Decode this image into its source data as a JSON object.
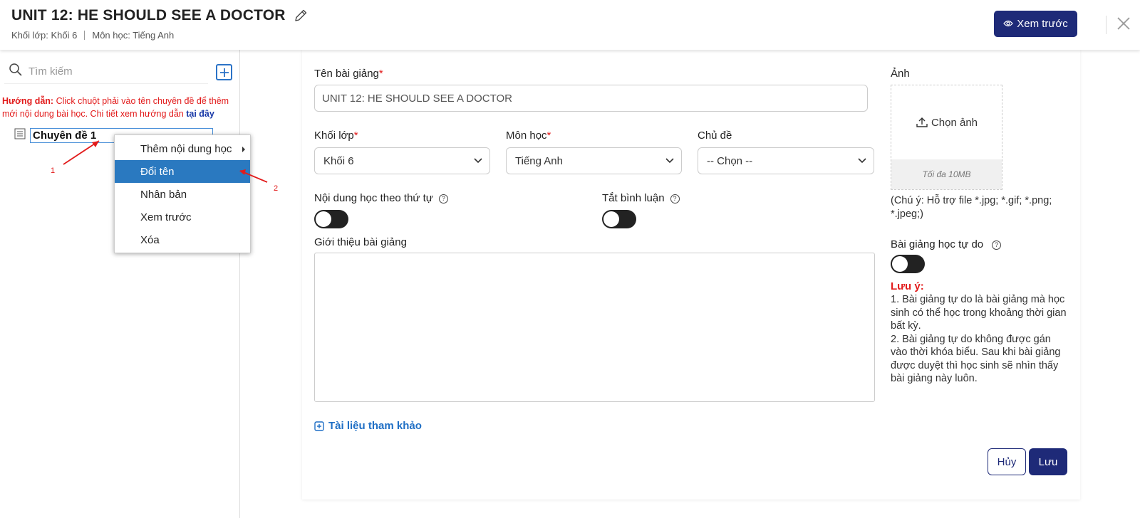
{
  "header": {
    "title": "UNIT 12: HE SHOULD SEE A DOCTOR",
    "grade_label": "Khối lớp: Khối 6",
    "subject_label": "Môn học: Tiếng Anh",
    "preview_button": "Xem trước"
  },
  "sidebar": {
    "search_placeholder": "Tìm kiếm",
    "guide_prefix": "Hướng dẫn:",
    "guide_text": " Click chuột phải vào tên chuyên đề để thêm mới nội dung bài học. Chi tiết xem hướng dẫn ",
    "guide_link": "tại đây",
    "tree": [
      {
        "label": "Chuyên đề 1"
      }
    ]
  },
  "context_menu": {
    "items": [
      {
        "label": "Thêm nội dung học",
        "has_submenu": true
      },
      {
        "label": "Đổi tên",
        "active": true
      },
      {
        "label": "Nhân bản"
      },
      {
        "label": "Xem trước"
      },
      {
        "label": "Xóa"
      }
    ]
  },
  "annotations": {
    "arrow_1": "1",
    "arrow_2": "2",
    "color": "#e21b1b"
  },
  "form": {
    "lesson_name_label": "Tên bài giảng",
    "lesson_name_value": "UNIT 12: HE SHOULD SEE A DOCTOR",
    "grade_label": "Khối lớp",
    "grade_value": "Khối 6",
    "subject_label": "Môn học",
    "subject_value": "Tiếng Anh",
    "topic_label": "Chủ đề",
    "topic_value": "-- Chọn --",
    "sequential_label": "Nội dung học theo thứ tự",
    "disable_comments_label": "Tắt bình luận",
    "intro_label": "Giới thiệu bài giảng",
    "reference_link": "Tài liệu tham khảo",
    "cancel_button": "Hủy",
    "save_button": "Lưu"
  },
  "image_panel": {
    "label": "Ảnh",
    "choose_image": "Chọn ảnh",
    "max_size": "Tối đa 10MB",
    "support_note": "(Chú ý: Hỗ trợ file *.jpg; *.gif; *.png; *.jpeg;)",
    "free_lesson_label": "Bài giảng học tự do",
    "warning_title": "Lưu ý:",
    "warning_1": "1. Bài giảng tự do là bài giảng mà học sinh có thể học trong khoảng thời gian bất kỳ.",
    "warning_2": "2. Bài giảng tự do không được gán vào thời khóa biểu. Sau khi bài giảng được duyệt thì học sinh sẽ nhìn thấy bài giảng này luôn."
  },
  "colors": {
    "primary": "#1e2a78",
    "menu_active": "#2a79c0",
    "link": "#1f6fc5",
    "required": "#e21b1b"
  }
}
